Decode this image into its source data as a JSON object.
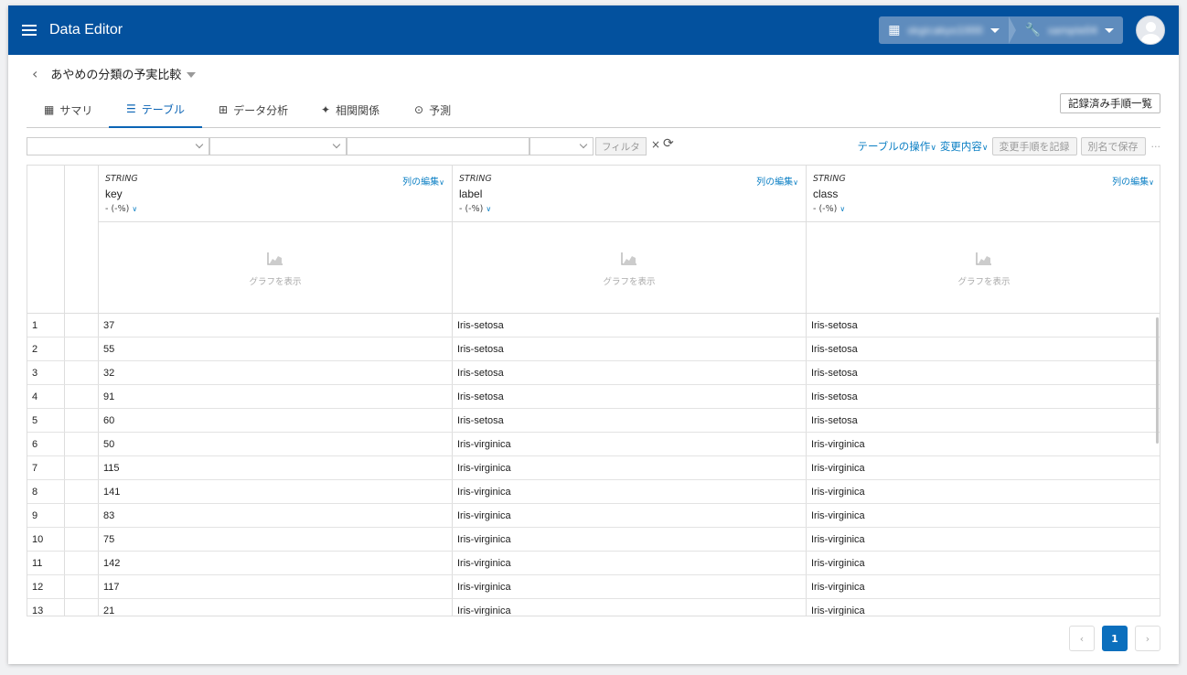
{
  "appbar": {
    "title": "Data Editor",
    "org_label": "skgicakyo1000",
    "project_label": "sample04",
    "org_icon": "building-icon",
    "project_icon": "wrench-icon"
  },
  "page": {
    "title": "あやめの分類の予実比較"
  },
  "tabs": [
    {
      "label": "サマリ",
      "icon": "grid-icon",
      "active": false
    },
    {
      "label": "テーブル",
      "icon": "list-icon",
      "active": true
    },
    {
      "label": "データ分析",
      "icon": "plus-box-icon",
      "active": false
    },
    {
      "label": "相関関係",
      "icon": "lightbulb-icon",
      "active": false
    },
    {
      "label": "予測",
      "icon": "magnifier-chart-icon",
      "active": false
    }
  ],
  "recorded_steps_button": "記録済み手順一覧",
  "filter": {
    "button": "フィルタ",
    "clear": "×"
  },
  "ops": {
    "table_ops": "テーブルの操作",
    "changes": "変更内容",
    "record_changes": "変更手順を記録",
    "save_as": "別名で保存",
    "more": "···"
  },
  "columns": [
    {
      "type": "STRING",
      "name": "key",
      "stat": "- (-%)",
      "edit": "列の編集",
      "chart_label": "グラフを表示"
    },
    {
      "type": "STRING",
      "name": "label",
      "stat": "- (-%)",
      "edit": "列の編集",
      "chart_label": "グラフを表示"
    },
    {
      "type": "STRING",
      "name": "class",
      "stat": "- (-%)",
      "edit": "列の編集",
      "chart_label": "グラフを表示"
    }
  ],
  "rows": [
    {
      "n": "1",
      "key": "37",
      "label": "Iris-setosa",
      "class": "Iris-setosa"
    },
    {
      "n": "2",
      "key": "55",
      "label": "Iris-setosa",
      "class": "Iris-setosa"
    },
    {
      "n": "3",
      "key": "32",
      "label": "Iris-setosa",
      "class": "Iris-setosa"
    },
    {
      "n": "4",
      "key": "91",
      "label": "Iris-setosa",
      "class": "Iris-setosa"
    },
    {
      "n": "5",
      "key": "60",
      "label": "Iris-setosa",
      "class": "Iris-setosa"
    },
    {
      "n": "6",
      "key": "50",
      "label": "Iris-virginica",
      "class": "Iris-virginica"
    },
    {
      "n": "7",
      "key": "115",
      "label": "Iris-virginica",
      "class": "Iris-virginica"
    },
    {
      "n": "8",
      "key": "141",
      "label": "Iris-virginica",
      "class": "Iris-virginica"
    },
    {
      "n": "9",
      "key": "83",
      "label": "Iris-virginica",
      "class": "Iris-virginica"
    },
    {
      "n": "10",
      "key": "75",
      "label": "Iris-virginica",
      "class": "Iris-virginica"
    },
    {
      "n": "11",
      "key": "142",
      "label": "Iris-virginica",
      "class": "Iris-virginica"
    },
    {
      "n": "12",
      "key": "117",
      "label": "Iris-virginica",
      "class": "Iris-virginica"
    },
    {
      "n": "13",
      "key": "21",
      "label": "Iris-virginica",
      "class": "Iris-virginica"
    }
  ],
  "pager": {
    "prev": "‹",
    "current": "1",
    "next": "›"
  },
  "colors": {
    "appbar": "#03519e",
    "accent": "#0b7fc4",
    "active_tab": "#0b64b5"
  }
}
